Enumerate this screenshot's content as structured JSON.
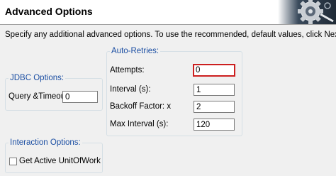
{
  "header": {
    "title": "Advanced Options"
  },
  "description": "Specify any additional advanced options.  To use the recommended, default values, click Next.",
  "auto_retries": {
    "title": "Auto-Retries:",
    "attempts": {
      "label": "Attempts:",
      "value": "0"
    },
    "interval": {
      "label": "Interval (s):",
      "value": "1"
    },
    "backoff": {
      "label": "Backoff Factor: x",
      "value": "2"
    },
    "max_interval": {
      "label": "Max Interval (s):",
      "value": "120"
    }
  },
  "jdbc": {
    "title": "JDBC Options:",
    "query_timeout": {
      "label": "Query &Timeout:",
      "value": "0"
    }
  },
  "interaction": {
    "title": "Interaction Options:",
    "get_active_uow": {
      "label": "Get Active UnitOfWork",
      "checked": false
    }
  },
  "colors": {
    "group_title": "#1c4fa3",
    "error_border": "#cc1f1f",
    "header_bg": "#ffffff",
    "body_bg": "#f0f0f0"
  }
}
